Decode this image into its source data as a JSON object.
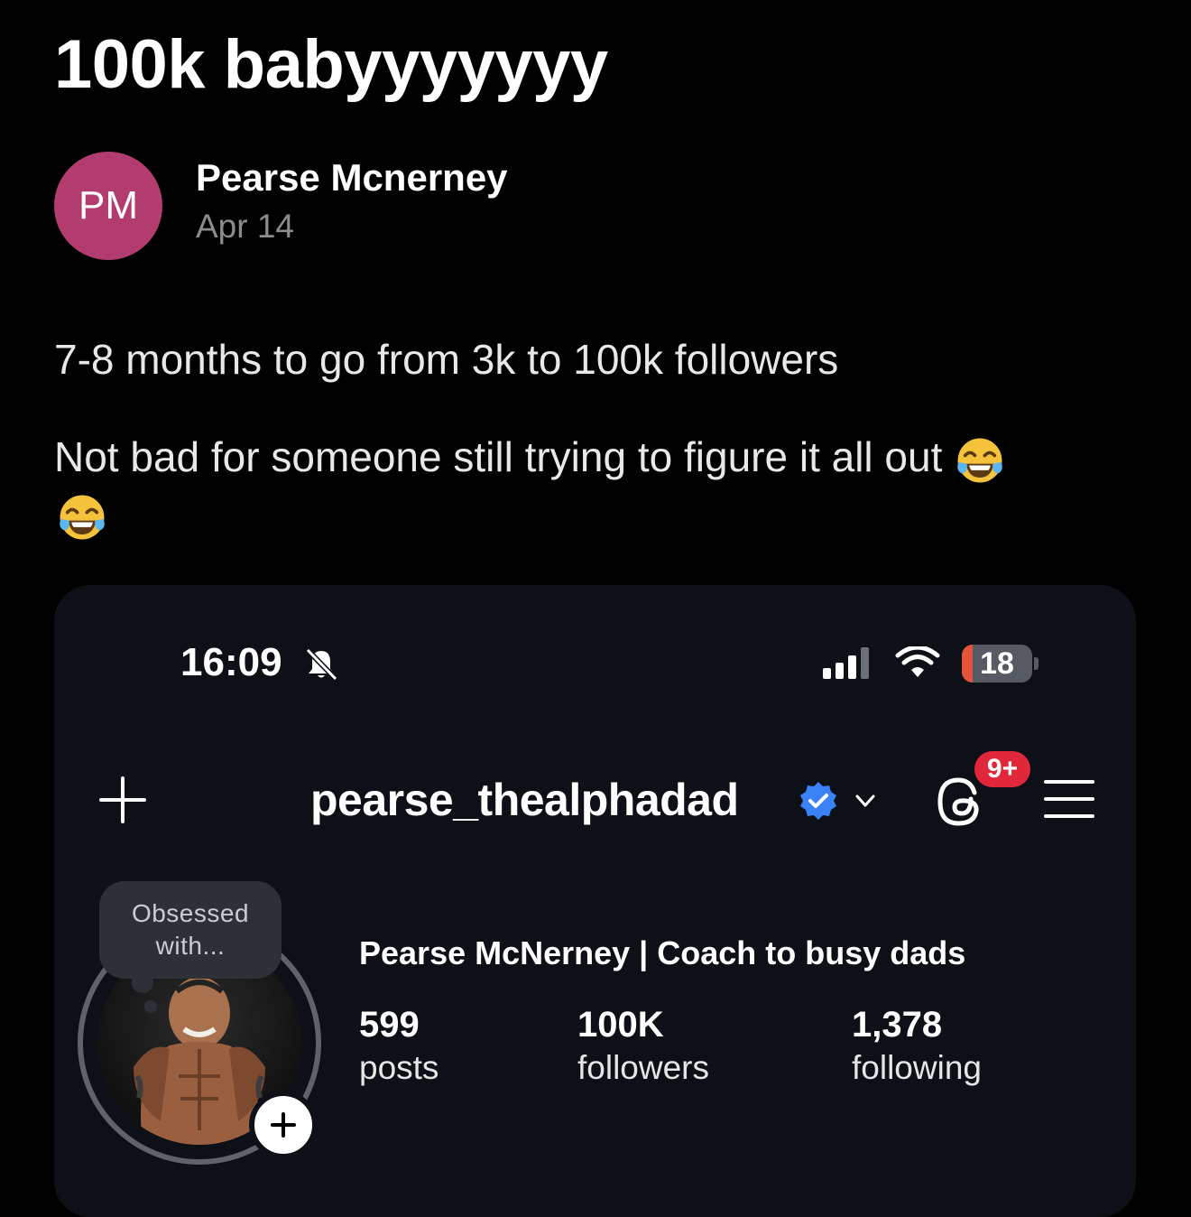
{
  "post": {
    "title": "100k babyyyyyyy",
    "author": {
      "initials": "PM",
      "name": "Pearse Mcnerney",
      "date": "Apr 14",
      "avatar_color": "#b33c6e"
    },
    "body": {
      "line1": "7-8 months to go from 3k to 100k followers",
      "line2": "Not bad for someone still trying to figure it all out",
      "emoji": "face-with-tears-of-joy"
    }
  },
  "screenshot": {
    "status_bar": {
      "time": "16:09",
      "silent_icon": "bell-slash-icon",
      "battery": "18",
      "battery_color": "#e5533b"
    },
    "header": {
      "username": "pearse_thealphadad",
      "verified_icon": "verified-badge-icon",
      "verified_color": "#3b82f6",
      "notification_badge": "9+",
      "badge_color": "#e0283a"
    },
    "profile": {
      "note": "Obsessed with...",
      "full_name": "Pearse McNerney | Coach to busy dads",
      "stats": [
        {
          "value": "599",
          "label": "posts"
        },
        {
          "value": "100K",
          "label": "followers"
        },
        {
          "value": "1,378",
          "label": "following"
        }
      ]
    }
  }
}
